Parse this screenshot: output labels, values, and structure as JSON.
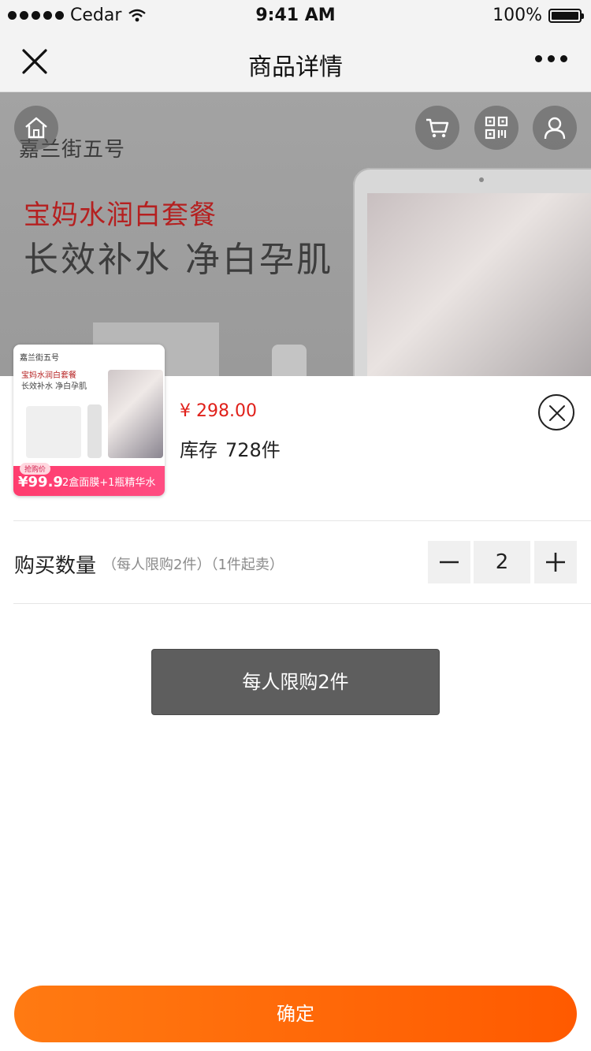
{
  "status_bar": {
    "carrier": "Cedar",
    "time": "9:41 AM",
    "battery": "100%",
    "signal_icon": "signal-dots-icon",
    "wifi_icon": "wifi-icon",
    "battery_icon": "battery-icon"
  },
  "nav": {
    "title": "商品详情",
    "close_icon": "close-icon",
    "more_icon": "more-icon"
  },
  "hero": {
    "brand": "嘉兰街五号",
    "tagline": "宝妈水润白套餐",
    "headline": "长效补水  净白孕肌",
    "buttons": [
      "home-icon",
      "cart-icon",
      "qrcode-icon",
      "user-icon"
    ]
  },
  "product": {
    "thumb": {
      "brand": "嘉兰街五号",
      "tagline": "宝妈水润白套餐",
      "headline": "长效补水  净白孕肌",
      "badge_label": "抢购价",
      "badge_price": "¥99.9",
      "promo": "2盒面膜+1瓶精华水"
    },
    "price": "¥ 298.00",
    "stock_label": "库存",
    "stock_value": "728件"
  },
  "quantity": {
    "label": "购买数量",
    "note": "（每人限购2件）（1件起卖）",
    "value": "2",
    "minus_icon": "minus-icon",
    "plus_icon": "plus-icon"
  },
  "limit_button": "每人限购2件",
  "confirm_button": "确定",
  "colors": {
    "price": "#e0201a",
    "confirm_start": "#ff7a12",
    "confirm_end": "#ff5a00",
    "limit_bg": "#5e5e5e"
  }
}
